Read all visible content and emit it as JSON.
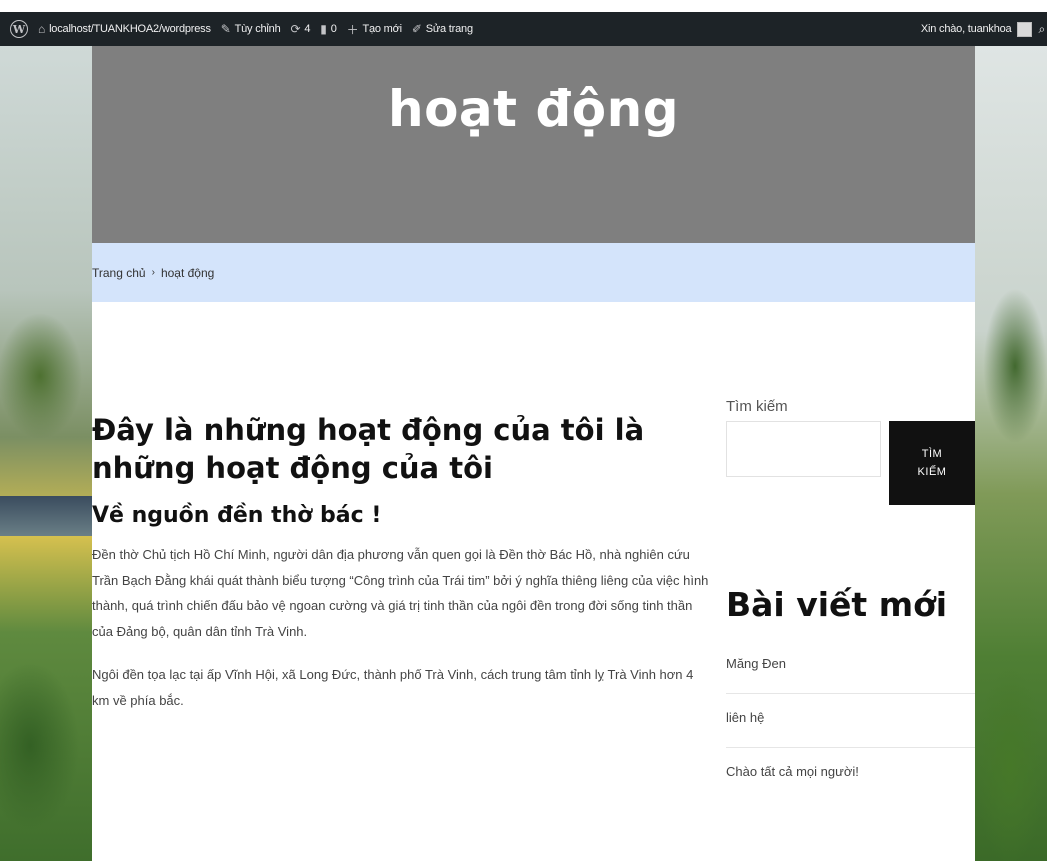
{
  "admin_bar": {
    "wp_logo": "W",
    "site_url": "localhost/TUANKHOA2/wordpress",
    "customize": "Tùy chỉnh",
    "updates_count": "4",
    "comments_count": "0",
    "new": "Tạo mới",
    "edit_page": "Sửa trang",
    "greeting": "Xin chào, tuankhoa",
    "icons": [
      "wordpress-logo-icon",
      "dashboard-icon",
      "brush-icon",
      "updates-icon",
      "comment-icon",
      "plus-icon",
      "pencil-icon",
      "avatar",
      "search-icon"
    ]
  },
  "hero": {
    "title": "hoạt động"
  },
  "breadcrumb": {
    "home": "Trang chủ",
    "separator": "›",
    "current": "hoạt động"
  },
  "content": {
    "heading": "Đây là những hoạt động của tôi là những hoạt động của tôi",
    "subheading": "Về nguồn đền thờ bác !",
    "paragraphs": [
      "Đền thờ Chủ tịch Hồ Chí Minh, người dân địa phương vẫn quen gọi là Đền thờ Bác Hồ, nhà nghiên cứu Trần Bạch Đằng khái quát thành biểu tượng “Công trình của Trái tim” bởi ý nghĩa thiêng liêng của việc hình thành, quá trình chiến đấu bảo vệ ngoan cường và giá trị tinh thần của ngôi đền trong đời sống tinh thần của Đảng bộ, quân dân tỉnh Trà Vinh.",
      "Ngôi đền tọa lạc tại ấp Vĩnh Hội, xã Long Đức, thành phố Trà Vinh, cách trung tâm tỉnh lỵ Trà Vinh hơn 4 km về phía bắc."
    ]
  },
  "sidebar": {
    "search_label": "Tìm kiếm",
    "search_value": "",
    "search_button": "TÌM KIẾM",
    "recent_title": "Bài viết mới",
    "recent_posts": [
      "Măng Đen",
      "liên hệ",
      "Chào tất cả mọi người!"
    ]
  },
  "colors": {
    "admin_bar": "#1d2327",
    "hero": "#7f7f7f",
    "breadcrumb": "#d4e4fb",
    "button": "#111111"
  }
}
